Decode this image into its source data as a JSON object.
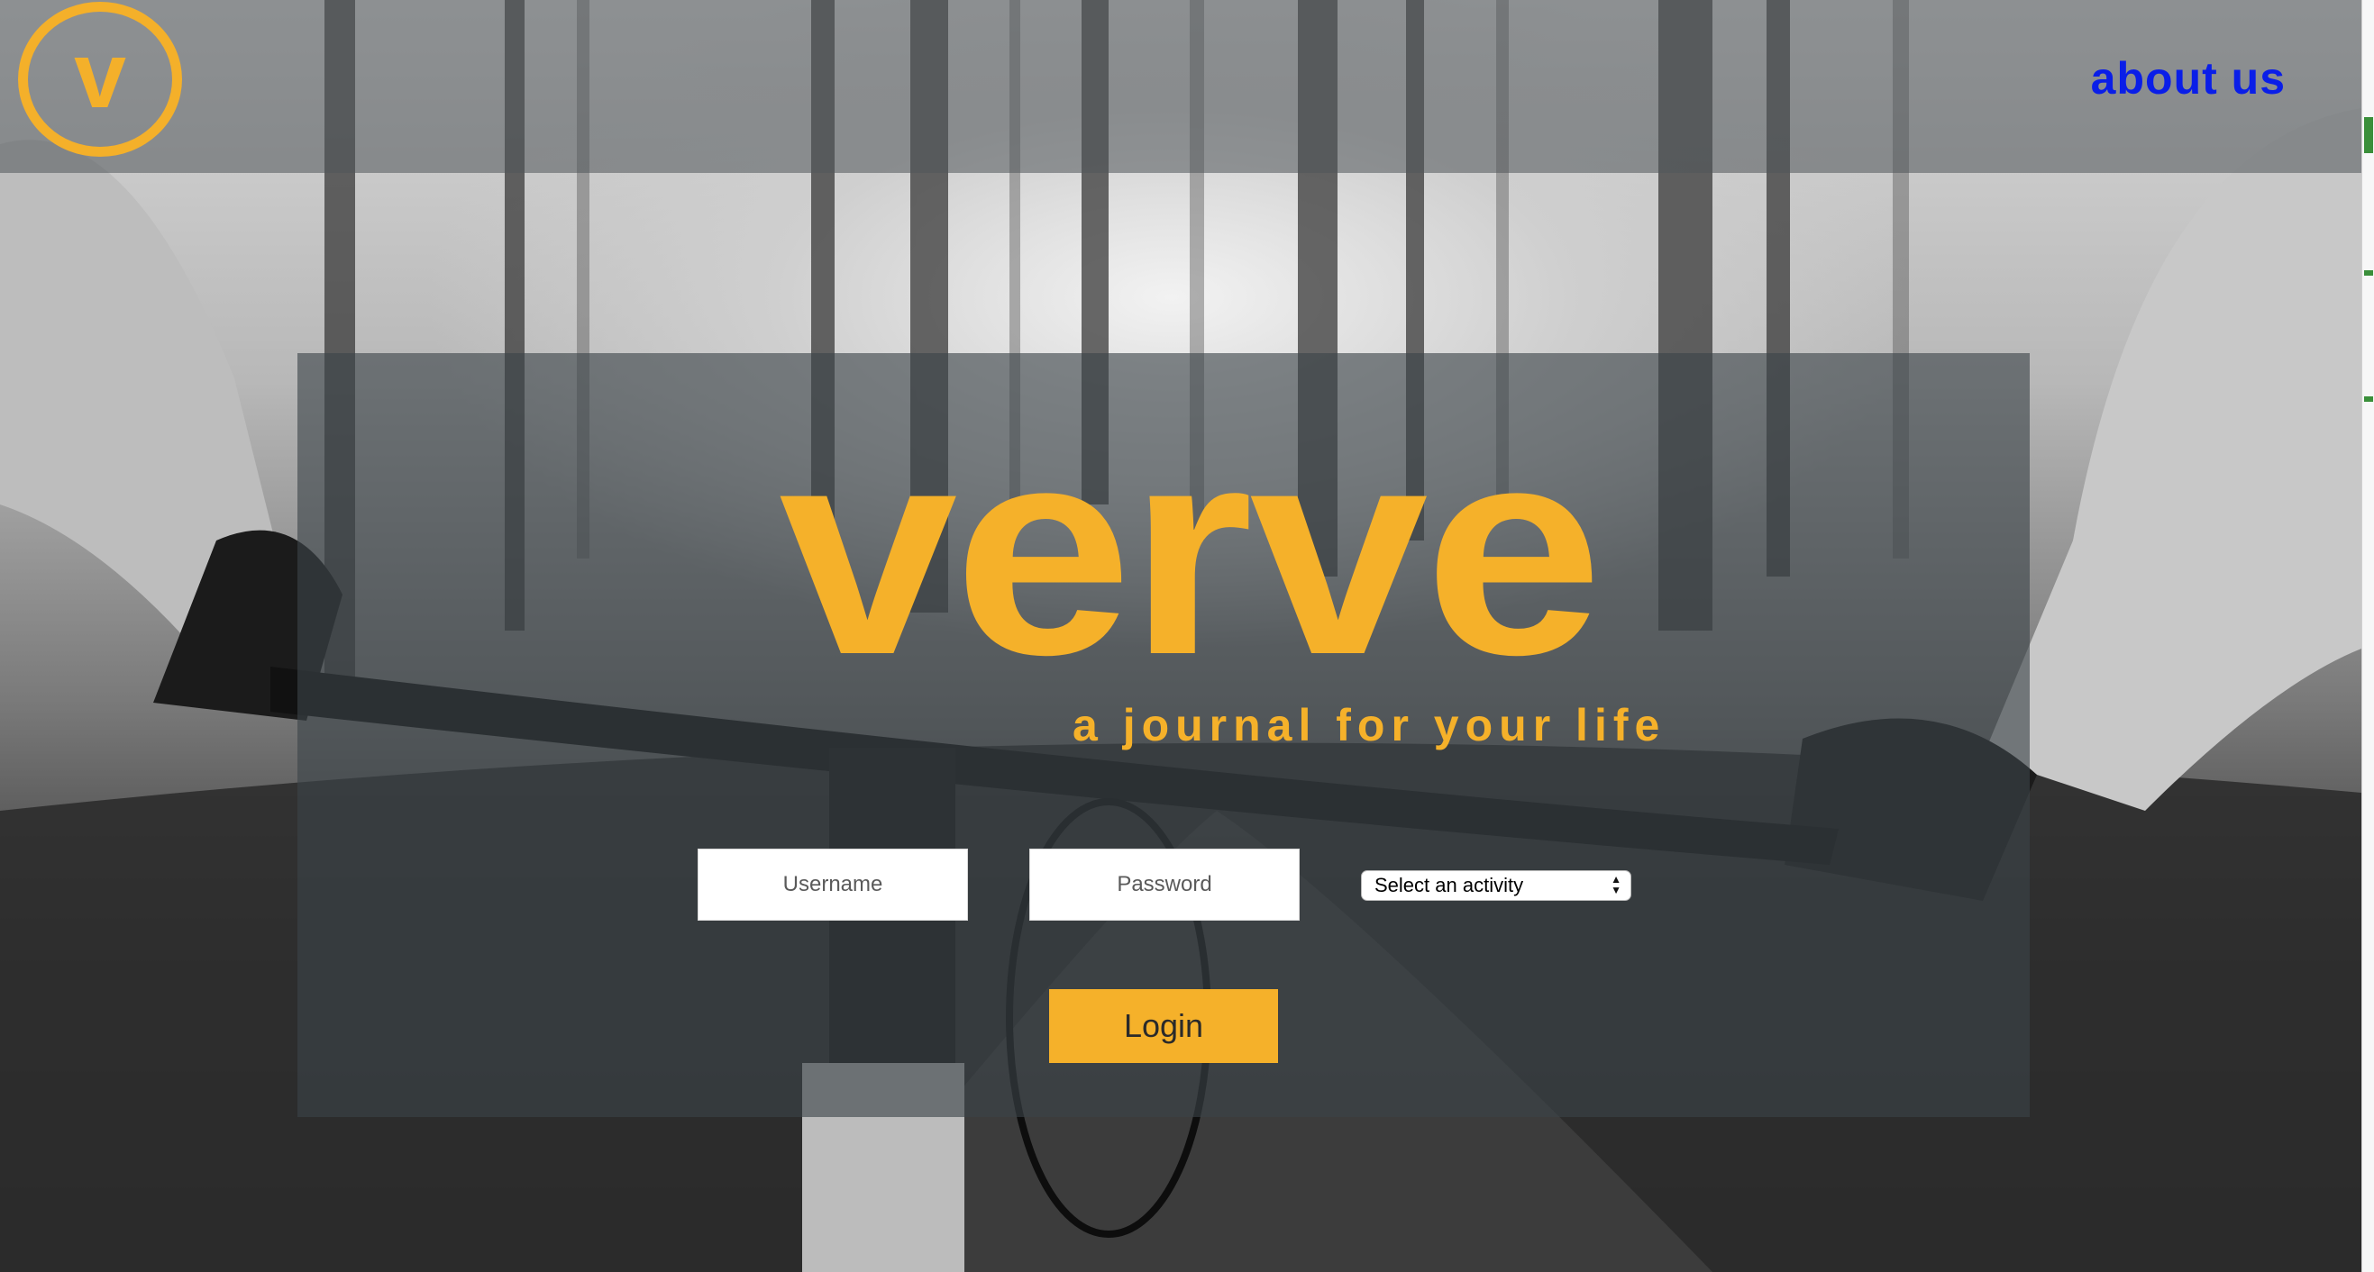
{
  "header": {
    "logo_letter": "v",
    "about_link": "about us"
  },
  "hero": {
    "brand": "verve",
    "tagline": "a journal for your life"
  },
  "login_form": {
    "username_placeholder": "Username",
    "password_placeholder": "Password",
    "activity_select": {
      "selected": "Select an activity"
    },
    "login_button": "Login"
  },
  "colors": {
    "accent": "#f5b12a",
    "link": "#0a1ee8",
    "panel": "#3c4448"
  },
  "icons": {
    "select_arrows": "chevron-up-down-icon"
  }
}
